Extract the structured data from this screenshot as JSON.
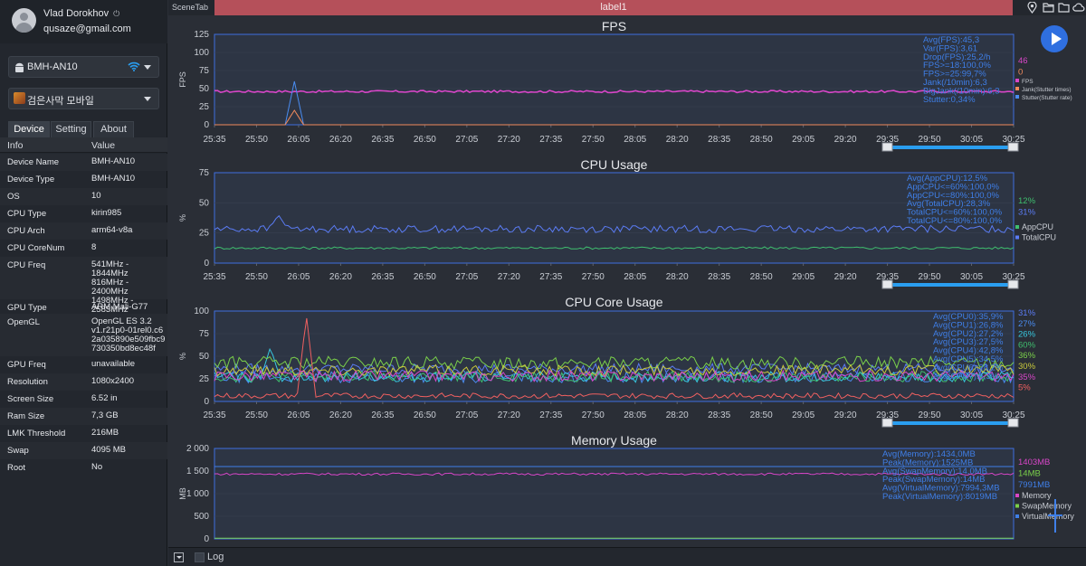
{
  "user": {
    "name": "Vlad Dorokhov",
    "power_glyph": "⏻",
    "email": "qusaze@gmail.com"
  },
  "device_select": {
    "value": "BMH-AN10",
    "icon": "android-icon",
    "wifi_icon": "wifi-icon"
  },
  "app_select": {
    "value": "검은사막 모바일",
    "icon": "game-icon"
  },
  "tabs": [
    {
      "label": "Device",
      "active": true
    },
    {
      "label": "Setting",
      "active": false
    },
    {
      "label": "About",
      "active": false
    }
  ],
  "info_table": {
    "headers": [
      "Info",
      "Value"
    ],
    "rows": [
      {
        "k": "Device Name",
        "v": "BMH-AN10"
      },
      {
        "k": "Device Type",
        "v": "BMH-AN10"
      },
      {
        "k": "OS",
        "v": "10"
      },
      {
        "k": "CPU Type",
        "v": "kirin985"
      },
      {
        "k": "CPU Arch",
        "v": "arm64-v8a"
      },
      {
        "k": "CPU CoreNum",
        "v": "8"
      },
      {
        "k": "CPU Freq",
        "v": "541MHz - 1844MHz\n816MHz - 2400MHz\n1498MHz -\n2583MHz"
      },
      {
        "k": "GPU Type",
        "v": "ARM Mali-G77"
      },
      {
        "k": "OpenGL",
        "v": "OpenGL ES 3.2\nv1.r21p0-01rel0.c6\n2a035890e509fbc9\n730350bd8ec48f"
      },
      {
        "k": "GPU Freq",
        "v": "unavailable"
      },
      {
        "k": "Resolution",
        "v": "1080x2400"
      },
      {
        "k": "Screen Size",
        "v": "6.52 in"
      },
      {
        "k": "Ram Size",
        "v": "7,3 GB"
      },
      {
        "k": "LMK Threshold",
        "v": "216MB"
      },
      {
        "k": "Swap",
        "v": "4095 MB"
      },
      {
        "k": "Root",
        "v": "No"
      }
    ]
  },
  "topbar": {
    "scene_tab": "SceneTab",
    "label_tab": "label1",
    "icons": [
      "location-pin-icon",
      "folder-icon",
      "folder-outline-icon",
      "cloud-icon"
    ]
  },
  "bottombar": {
    "log_label": "Log"
  },
  "colors": {
    "fps": "#d846c8",
    "jank": "#f08a5c",
    "stutter": "#4a8cf0",
    "appcpu": "#3fbf6f",
    "totalcpu": "#5b7cf5",
    "memory": "#d846c8",
    "swap": "#7ad04a",
    "virtual": "#3f7fe8",
    "stats_text": "#3f7fe8",
    "accent": "#2a9ef0"
  },
  "chart_data": [
    {
      "type": "line",
      "title": "FPS",
      "ylabel": "FPS",
      "ylim": [
        0,
        125
      ],
      "yticks": [
        "0",
        "25",
        "50",
        "75",
        "100",
        "125"
      ],
      "x_ticks": [
        "25:35",
        "25:50",
        "26:05",
        "26:20",
        "26:35",
        "26:50",
        "27:05",
        "27:20",
        "27:35",
        "27:50",
        "28:05",
        "28:20",
        "28:35",
        "28:50",
        "29:05",
        "29:20",
        "29:35",
        "29:50",
        "30:05",
        "30:25"
      ],
      "stats": [
        "Avg(FPS):45,3",
        "Var(FPS):3,61",
        "Drop(FPS):25,2/h",
        "FPS>=18:100,0%",
        "FPS>=25:99,7%",
        "Jank(/10min):6,3",
        "BigJank(/10min):6,3",
        "Stutter:0,34%"
      ],
      "current_values": [
        {
          "text": "46",
          "color": "#d846c8"
        },
        {
          "text": "0",
          "color": "#f08a5c"
        }
      ],
      "legend": [
        {
          "name": "FPS",
          "color": "#d846c8"
        },
        {
          "name": "Jank(Stutter times)",
          "color": "#f08a5c"
        },
        {
          "name": "Stutter(Stutter rate)",
          "color": "#4a8cf0"
        }
      ],
      "series": [
        {
          "name": "FPS",
          "baseline": 46,
          "noise": 1.5,
          "spikes": []
        },
        {
          "name": "Stutter",
          "baseline": 0,
          "noise": 0,
          "spikes": [
            {
              "t": 0.1,
              "v": 60
            }
          ]
        },
        {
          "name": "Jank",
          "baseline": 0,
          "noise": 0,
          "spikes": [
            {
              "t": 0.1,
              "v": 20
            }
          ]
        }
      ]
    },
    {
      "type": "line",
      "title": "CPU Usage",
      "ylabel": "%",
      "ylim": [
        0,
        75
      ],
      "yticks": [
        "0",
        "25",
        "50",
        "75"
      ],
      "x_ticks": [
        "25:35",
        "25:50",
        "26:05",
        "26:20",
        "26:35",
        "26:50",
        "27:05",
        "27:20",
        "27:35",
        "27:50",
        "28:05",
        "28:20",
        "28:35",
        "28:50",
        "29:05",
        "29:20",
        "29:35",
        "29:50",
        "30:05",
        "30:25"
      ],
      "stats": [
        "Avg(AppCPU):12,5%",
        "AppCPU<=60%:100,0%",
        "AppCPU<=80%:100,0%",
        "Avg(TotalCPU):28,3%",
        "TotalCPU<=60%:100,0%",
        "TotalCPU<=80%:100,0%"
      ],
      "current_values": [
        {
          "text": "12%",
          "color": "#3fbf6f"
        },
        {
          "text": "31%",
          "color": "#5b7cf5"
        }
      ],
      "legend": [
        {
          "name": "AppCPU",
          "color": "#3fbf6f"
        },
        {
          "name": "TotalCPU",
          "color": "#5b7cf5"
        }
      ],
      "series": [
        {
          "name": "AppCPU",
          "baseline": 12.5,
          "noise": 1,
          "spikes": []
        },
        {
          "name": "TotalCPU",
          "baseline": 28.3,
          "noise": 3,
          "spikes": [
            {
              "t": 0.08,
              "v": 40
            }
          ]
        }
      ]
    },
    {
      "type": "line",
      "title": "CPU Core Usage",
      "ylabel": "%",
      "ylim": [
        0,
        100
      ],
      "yticks": [
        "0",
        "25",
        "50",
        "75",
        "100"
      ],
      "x_ticks": [
        "25:35",
        "25:50",
        "26:05",
        "26:20",
        "26:35",
        "26:50",
        "27:05",
        "27:20",
        "27:35",
        "27:50",
        "28:05",
        "28:20",
        "28:35",
        "28:50",
        "29:05",
        "29:20",
        "29:35",
        "29:50",
        "30:05",
        "30:25"
      ],
      "stats": [
        "Avg(CPU0):35,9%",
        "Avg(CPU1):26,8%",
        "Avg(CPU2):27,2%",
        "Avg(CPU3):27,5%",
        "Avg(CPU4):42,8%",
        "Avg(CPU5):34,5%",
        "Avg(CPU6):28,2%",
        "Avg(CPU7):6,3%"
      ],
      "current_values": [
        {
          "text": "31%",
          "color": "#5b7cf5"
        },
        {
          "text": "27%",
          "color": "#4a8cf0"
        },
        {
          "text": "26%",
          "color": "#37c8e0"
        },
        {
          "text": "60%",
          "color": "#3fbf6f"
        },
        {
          "text": "36%",
          "color": "#7ad04a"
        },
        {
          "text": "30%",
          "color": "#c9c93c"
        },
        {
          "text": "35%",
          "color": "#d846c8"
        },
        {
          "text": "5%",
          "color": "#f06060"
        }
      ],
      "legend": [],
      "series": [
        {
          "name": "CPU0",
          "baseline": 35.9,
          "noise": 6,
          "color": "#5b7cf5",
          "spikes": []
        },
        {
          "name": "CPU1",
          "baseline": 26.8,
          "noise": 6,
          "color": "#4a8cf0",
          "spikes": []
        },
        {
          "name": "CPU2",
          "baseline": 27.2,
          "noise": 6,
          "color": "#37c8e0",
          "spikes": [
            {
              "t": 0.07,
              "v": 60
            }
          ]
        },
        {
          "name": "CPU3",
          "baseline": 27.5,
          "noise": 6,
          "color": "#3fbf6f",
          "spikes": []
        },
        {
          "name": "CPU4",
          "baseline": 42.8,
          "noise": 7,
          "color": "#7ad04a",
          "spikes": []
        },
        {
          "name": "CPU5",
          "baseline": 34.5,
          "noise": 6,
          "color": "#c9c93c",
          "spikes": []
        },
        {
          "name": "CPU6",
          "baseline": 28.2,
          "noise": 6,
          "color": "#d846c8",
          "spikes": []
        },
        {
          "name": "CPU7",
          "baseline": 6.3,
          "noise": 3,
          "color": "#f06060",
          "spikes": [
            {
              "t": 0.115,
              "v": 95
            }
          ]
        }
      ]
    },
    {
      "type": "line",
      "title": "Memory Usage",
      "ylabel": "MB",
      "ylim": [
        0,
        2000
      ],
      "yticks": [
        "0",
        "500",
        "1 000",
        "1 500",
        "2 000"
      ],
      "x_ticks": [],
      "stats": [
        "Avg(Memory):1434,0MB",
        "Peak(Memory):1525MB",
        "Avg(SwapMemory):14,0MB",
        "Peak(SwapMemory):14MB",
        "Avg(VirtualMemory):7994,3MB",
        "Peak(VirtualMemory):8019MB"
      ],
      "current_values": [
        {
          "text": "1403MB",
          "color": "#d846c8"
        },
        {
          "text": "14MB",
          "color": "#7ad04a"
        },
        {
          "text": "7991MB",
          "color": "#3f7fe8"
        }
      ],
      "legend": [
        {
          "name": "Memory",
          "color": "#d846c8"
        },
        {
          "name": "SwapMemory",
          "color": "#7ad04a"
        },
        {
          "name": "VirtualMemory",
          "color": "#3f7fe8"
        }
      ],
      "series": [
        {
          "name": "Memory",
          "baseline": 1434,
          "noise": 25,
          "spikes": []
        },
        {
          "name": "SwapMemory",
          "baseline": 14,
          "noise": 0,
          "spikes": []
        },
        {
          "name": "VirtualMemory",
          "baseline": 1600,
          "noise": 0,
          "spikes": []
        }
      ]
    }
  ]
}
